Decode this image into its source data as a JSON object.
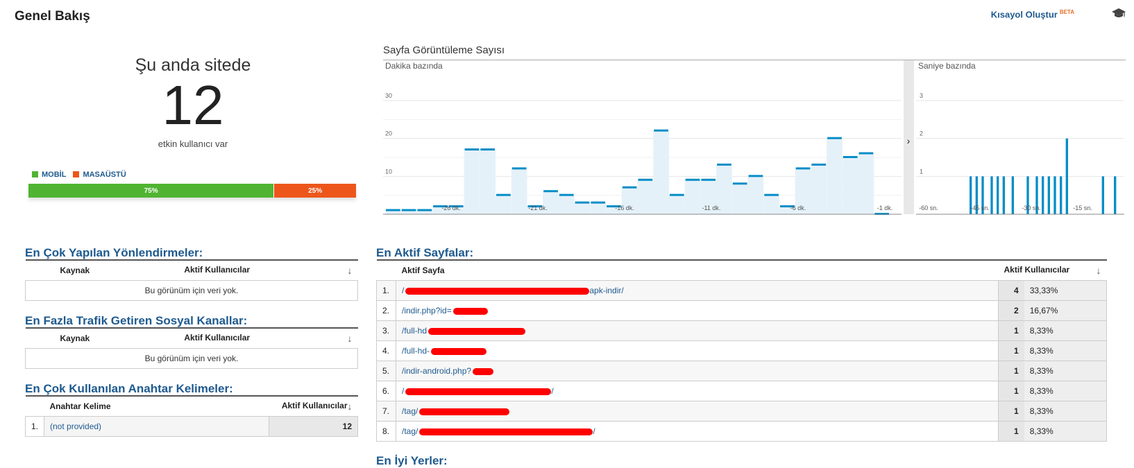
{
  "header": {
    "title": "Genel Bakış",
    "shortcut_label": "Kısayol Oluştur",
    "shortcut_badge": "BETA",
    "cap_icon": "graduation-cap-icon"
  },
  "realtime": {
    "title": "Şu anda sitede",
    "count": "12",
    "subtitle": "etkin kullanıcı var",
    "legend": [
      {
        "label": "MOBİL",
        "color": "#50b432"
      },
      {
        "label": "MASAÜSTÜ",
        "color": "#ed561b"
      }
    ],
    "split": [
      {
        "label": "75%",
        "fraction": 0.75,
        "color": "#50b432"
      },
      {
        "label": "25%",
        "fraction": 0.25,
        "color": "#ed561b"
      }
    ]
  },
  "chart_data": [
    {
      "type": "bar",
      "title": "Sayfa Görüntüleme Sayısı",
      "subtitle": "Dakika bazında",
      "ylim": [
        0,
        30
      ],
      "yticks": [
        "10",
        "20",
        "30"
      ],
      "xticks": [
        "-26 dk.",
        "-21 dk.",
        "-16 dk.",
        "-11 dk.",
        "-6 dk.",
        "-1 dk."
      ],
      "values": [
        1,
        1,
        1,
        2,
        2,
        17,
        17,
        5,
        12,
        2,
        6,
        5,
        3,
        3,
        2,
        7,
        9,
        22,
        5,
        9,
        9,
        13,
        8,
        10,
        5,
        2,
        12,
        13,
        20,
        15,
        16,
        0
      ],
      "color": "#058dc7"
    },
    {
      "type": "bar",
      "subtitle": "Saniye bazında",
      "ylim": [
        0,
        3
      ],
      "yticks": [
        "1",
        "2",
        "3"
      ],
      "xticks": [
        "-60 sn.",
        "-45 sn.",
        "-30 sn.",
        "-15 sn."
      ],
      "values": [
        0,
        0,
        0,
        0,
        0,
        0,
        0,
        0,
        0,
        1,
        0,
        1,
        0,
        1,
        0,
        0,
        1,
        0,
        1,
        0,
        1,
        0,
        0,
        1,
        0,
        0,
        0,
        0,
        1,
        0,
        0,
        1,
        0,
        1,
        0,
        1,
        0,
        1,
        0,
        1,
        0,
        2,
        0,
        0,
        0,
        0,
        0,
        0,
        0,
        0,
        0,
        0,
        0,
        1,
        0,
        0,
        0,
        1,
        0,
        0
      ],
      "color": "#058dc7"
    }
  ],
  "referrals": {
    "title": "En Çok Yapılan Yönlendirmeler:",
    "col_source": "Kaynak",
    "col_active": "Aktif Kullanıcılar",
    "empty": "Bu görünüm için veri yok."
  },
  "social": {
    "title": "En Fazla Trafik Getiren Sosyal Kanallar:",
    "col_source": "Kaynak",
    "col_active": "Aktif Kullanıcılar",
    "empty": "Bu görünüm için veri yok."
  },
  "keywords": {
    "title": "En Çok Kullanılan Anahtar Kelimeler:",
    "col_keyword": "Anahtar Kelime",
    "col_active": "Aktif Kullanıcılar",
    "rows": [
      {
        "n": "1.",
        "keyword": "(not provided)",
        "value": "12"
      }
    ]
  },
  "pages": {
    "title": "En Aktif Sayfalar:",
    "col_page": "Aktif Sayfa",
    "col_active": "Aktif Kullanıcılar",
    "rows": [
      {
        "n": "1.",
        "page": "/",
        "tail": "apk-indir/",
        "value": "4",
        "pct": "33,33%"
      },
      {
        "n": "2.",
        "page": "/indir.php?id=",
        "tail": "",
        "value": "2",
        "pct": "16,67%"
      },
      {
        "n": "3.",
        "page": "/full-hd",
        "tail": "",
        "value": "1",
        "pct": "8,33%"
      },
      {
        "n": "4.",
        "page": "/full-hd-",
        "tail": "",
        "value": "1",
        "pct": "8,33%"
      },
      {
        "n": "5.",
        "page": "/indir-android.php?",
        "tail": "",
        "value": "1",
        "pct": "8,33%"
      },
      {
        "n": "6.",
        "page": "/",
        "tail": "/",
        "value": "1",
        "pct": "8,33%"
      },
      {
        "n": "7.",
        "page": "/tag/",
        "tail": "",
        "value": "1",
        "pct": "8,33%"
      },
      {
        "n": "8.",
        "page": "/tag/",
        "tail": "/",
        "value": "1",
        "pct": "8,33%"
      }
    ]
  },
  "locations": {
    "title": "En İyi Yerler:"
  }
}
